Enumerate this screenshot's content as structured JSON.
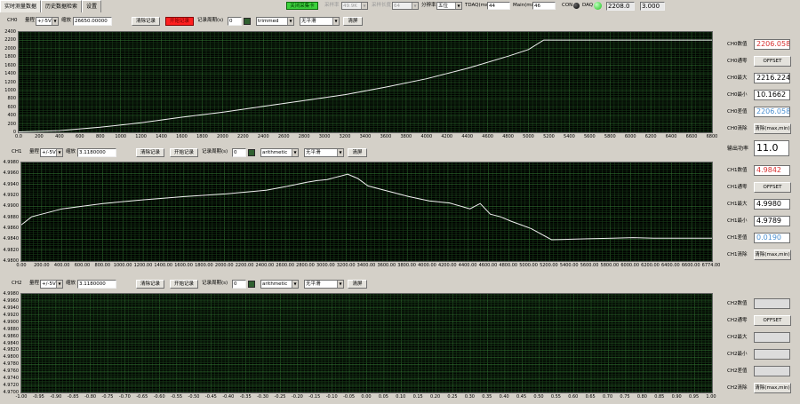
{
  "tabs": [
    "实时测量数据",
    "历史数据检索",
    "设置"
  ],
  "toolbar": {
    "stop_btn": "关闭采集卡",
    "sample_rate_label": "采样率",
    "sample_rate_value": "49.9K",
    "sample_len_label": "采样长度",
    "sample_len_value": "64",
    "resolution_label": "分辨率",
    "resolution_value": "五位",
    "tdaq_label": "TDAQ(ms)",
    "tdaq_value": "44",
    "main_label": "Main(ms)",
    "main_value": "46",
    "con_label": "CON",
    "daq_label": "DAQ",
    "val1": "2208.0",
    "val2": "3.000"
  },
  "channels": [
    {
      "name": "CH0",
      "range_label": "量程",
      "range_value": "+/-5V",
      "scale_label": "缩放",
      "scale_value": "26650.00000",
      "clear_btn": "清除记录",
      "record_btn": "开始记录",
      "record_active": true,
      "period_label": "记录周期(s)",
      "period_value": "0",
      "filter": "trimmed",
      "smooth": "无平滑",
      "clear_screen": "清屏",
      "yticks": [
        "2400",
        "2200",
        "2000",
        "1800",
        "1600",
        "1400",
        "1200",
        "1000",
        "800",
        "600",
        "400",
        "200",
        "0"
      ],
      "xticks": [
        "0.0",
        "200",
        "400",
        "600",
        "800",
        "1000",
        "1200",
        "1400",
        "1600",
        "1800",
        "2000",
        "2200",
        "2400",
        "2600",
        "2800",
        "3000",
        "3200",
        "3400",
        "3600",
        "3800",
        "4000",
        "4200",
        "4400",
        "4600",
        "4800",
        "5000",
        "5200",
        "5400",
        "5600",
        "5800",
        "6000",
        "6200",
        "6400",
        "6600",
        "6800"
      ],
      "stats": [
        {
          "label": "CH0数值",
          "value": "2206.0585",
          "color": "#d83030"
        },
        {
          "label": "CH0通零",
          "button": "OFFSET"
        },
        {
          "label": "CH0最大",
          "value": "2216.2247",
          "color": "#000000"
        },
        {
          "label": "CH0最小",
          "value": "10.1662",
          "color": "#000000"
        },
        {
          "label": "CH0差值",
          "value": "2206.0585",
          "color": "#4a8fd0"
        },
        {
          "label": "CH0清除",
          "button": "清除(max,min)"
        }
      ]
    },
    {
      "name": "CH1",
      "range_label": "量程",
      "range_value": "+/-5V",
      "scale_label": "缩放",
      "scale_value": "3.1180000",
      "clear_btn": "清除记录",
      "record_btn": "开始记录",
      "record_active": false,
      "period_label": "记录周期(s)",
      "period_value": "0",
      "filter": "arithmetic",
      "smooth": "无平滑",
      "clear_screen": "清屏",
      "yticks": [
        "4.9980",
        "4.9960",
        "4.9940",
        "4.9920",
        "4.9900",
        "4.9880",
        "4.9860",
        "4.9840",
        "4.9820",
        "4.9800"
      ],
      "xticks": [
        "0.00",
        "200.00",
        "400.00",
        "600.00",
        "800.00",
        "1000.00",
        "1200.00",
        "1400.00",
        "1600.00",
        "1800.00",
        "2000.00",
        "2200.00",
        "2400.00",
        "2600.00",
        "2800.00",
        "3000.00",
        "3200.00",
        "3400.00",
        "3600.00",
        "3800.00",
        "4000.00",
        "4200.00",
        "4400.00",
        "4600.00",
        "4800.00",
        "5000.00",
        "5200.00",
        "5400.00",
        "5600.00",
        "5800.00",
        "6000.00",
        "6200.00",
        "6400.00",
        "6600.00",
        "6774.00"
      ],
      "stats": [
        {
          "label": "CH1数值",
          "value": "4.9842",
          "color": "#d83030"
        },
        {
          "label": "CH1通零",
          "button": "OFFSET"
        },
        {
          "label": "CH1最大",
          "value": "4.9980",
          "color": "#000000"
        },
        {
          "label": "CH1最小",
          "value": "4.9789",
          "color": "#000000"
        },
        {
          "label": "CH1差值",
          "value": "0.0190",
          "color": "#4a8fd0"
        },
        {
          "label": "CH1清除",
          "button": "清除(max,min)"
        }
      ]
    },
    {
      "name": "CH2",
      "range_label": "量程",
      "range_value": "+/-5V",
      "scale_label": "缩放",
      "scale_value": "3.1180000",
      "clear_btn": "清除记录",
      "record_btn": "开始记录",
      "record_active": false,
      "period_label": "记录周期(s)",
      "period_value": "0",
      "filter": "arithmetic",
      "smooth": "无平滑",
      "clear_screen": "清屏",
      "yticks": [
        "4.9980",
        "4.9960",
        "4.9940",
        "4.9920",
        "4.9900",
        "4.9880",
        "4.9860",
        "4.9840",
        "4.9820",
        "4.9800",
        "4.9780",
        "4.9760",
        "4.9740",
        "4.9720",
        "4.9700"
      ],
      "xticks": [
        "-1.00",
        "-0.95",
        "-0.90",
        "-0.85",
        "-0.80",
        "-0.75",
        "-0.70",
        "-0.65",
        "-0.60",
        "-0.55",
        "-0.50",
        "-0.45",
        "-0.40",
        "-0.35",
        "-0.30",
        "-0.25",
        "-0.20",
        "-0.15",
        "-0.10",
        "-0.05",
        "0.00",
        "0.05",
        "0.10",
        "0.15",
        "0.20",
        "0.25",
        "0.30",
        "0.35",
        "0.40",
        "0.45",
        "0.50",
        "0.55",
        "0.60",
        "0.65",
        "0.70",
        "0.75",
        "0.80",
        "0.85",
        "0.90",
        "0.95",
        "1.00"
      ],
      "stats": [
        {
          "label": "CH2数值"
        },
        {
          "label": "CH2通零",
          "button": "OFFSET"
        },
        {
          "label": "CH2最大"
        },
        {
          "label": "CH2最小"
        },
        {
          "label": "CH2差值"
        },
        {
          "label": "CH2清除",
          "button": "清除(max,min)"
        }
      ]
    }
  ],
  "output": {
    "label": "输出功率",
    "value": "11.0"
  },
  "chart_data": [
    {
      "type": "line",
      "xlim": [
        0,
        6800
      ],
      "ylim": [
        0,
        2400
      ],
      "grid": true,
      "series": [
        {
          "x": [
            0,
            400,
            800,
            1200,
            1600,
            2000,
            2400,
            2800,
            3200,
            3600,
            4000,
            4400,
            4800,
            5000,
            5150,
            5200,
            6800
          ],
          "y": [
            10,
            40,
            120,
            230,
            360,
            480,
            620,
            760,
            900,
            1080,
            1280,
            1530,
            1820,
            1980,
            2206,
            2206,
            2206
          ]
        }
      ]
    },
    {
      "type": "line",
      "xlim": [
        0,
        6774
      ],
      "ylim": [
        4.9797,
        4.9982
      ],
      "grid": true,
      "series": [
        {
          "x": [
            0,
            100,
            400,
            800,
            1200,
            1600,
            2000,
            2400,
            2600,
            2800,
            2900,
            3000,
            3100,
            3200,
            3300,
            3400,
            3600,
            3800,
            4000,
            4200,
            4400,
            4500,
            4600,
            4700,
            4800,
            5000,
            5200,
            5400,
            5600,
            5800,
            6000,
            6200,
            6400,
            6600,
            6774
          ],
          "y": [
            4.9865,
            4.988,
            4.9895,
            4.9905,
            4.9912,
            4.9918,
            4.9923,
            4.993,
            4.9937,
            4.9945,
            4.9948,
            4.995,
            4.9955,
            4.996,
            4.9952,
            4.9938,
            4.9928,
            4.9918,
            4.991,
            4.9906,
            4.9895,
            4.9905,
            4.9885,
            4.988,
            4.9872,
            4.9858,
            4.9837,
            4.9838,
            4.9839,
            4.984,
            4.9841,
            4.984,
            4.984,
            4.984,
            4.984
          ]
        }
      ]
    },
    {
      "type": "line",
      "xlim": [
        -1.0,
        1.0
      ],
      "ylim": [
        4.97,
        4.998
      ],
      "grid": true,
      "series": []
    }
  ]
}
